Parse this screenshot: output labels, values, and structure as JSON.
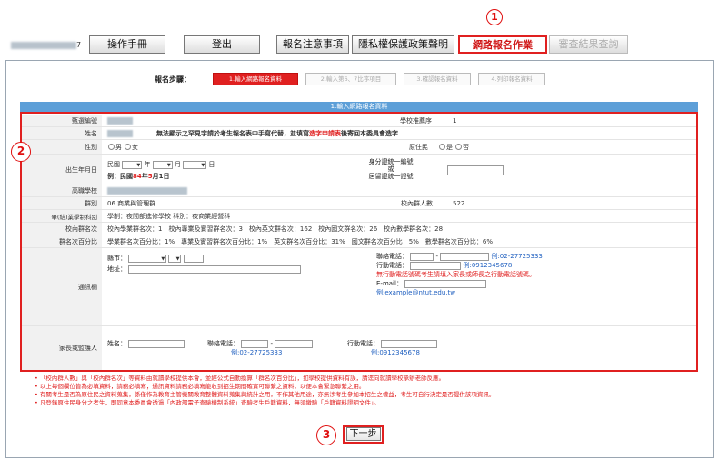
{
  "nav": {
    "user_suffix": "7",
    "buttons": [
      "操作手冊",
      "登出",
      "報名注意事項",
      "隱私權保護政策聲明",
      "網路報名作業",
      "審查結果查詢"
    ]
  },
  "markers": [
    "1",
    "2",
    "3"
  ],
  "steps": {
    "label": "報名步驟：",
    "items": [
      "1.輸入網路報名資料",
      "2.輸入第6、7比序項目",
      "3.確認報名資料",
      "4.列印報名資料"
    ]
  },
  "section_title": "1.輸入網路報名資料",
  "form": {
    "exam_no": {
      "label": "甄選編號"
    },
    "school_recommend": {
      "label": "學校推薦序",
      "value": "1"
    },
    "name": {
      "label": "姓名",
      "note_a": "無法顯示之罕見字請於考生報名表中手寫代替，並填寫",
      "note_b": "造字申請表",
      "note_c": "後寄回本委員會造字"
    },
    "gender": {
      "label": "性別",
      "opt_male": "男",
      "opt_female": "女"
    },
    "aboriginal": {
      "label": "原住民",
      "opt_yes": "是",
      "opt_no": "否"
    },
    "birth": {
      "label": "出生年月日",
      "era": "民國",
      "year_unit": "年",
      "month_unit": "月",
      "day_unit": "日",
      "example_prefix": "例：民國",
      "example_year": "84",
      "example_mid": "年",
      "example_month": "5",
      "example_suffix": "月1日"
    },
    "id": {
      "label_1": "身分證統一編號",
      "label_2": "或",
      "label_3": "居留證統一證號"
    },
    "high_school": {
      "label": "高職學校"
    },
    "group": {
      "label": "群別",
      "value": "06 商業與管理群"
    },
    "school_count": {
      "label": "校內群人數",
      "value": "522"
    },
    "dept": {
      "label": "畢(結)業學制科別",
      "value": "學制：夜間部進修學校 科別：夜商業經營科"
    },
    "rank": {
      "label": "校內群名次",
      "value": "校內學業群名次：1　校內專業及實習群名次：3　校內英文群名次：162　校內國文群名次：26　校內數學群名次：28"
    },
    "rank_pct": {
      "label": "群名次百分比",
      "value": "學業群名次百分比：1%　專業及實習群名次百分比：1%　英文群名次百分比：31%　國文群名次百分比：5%　數學群名次百分比：6%"
    },
    "contact": {
      "label": "通訊欄",
      "city": "縣市：",
      "address": "地址：",
      "phone": "聯絡電話：",
      "phone_example": "例:02-27725333",
      "mobile": "行動電話：",
      "mobile_example": "例:0912345678",
      "mobile_note": "無行動電話號碼考生請填入家長或師長之行動電話號碼。",
      "email": "E-mail：",
      "email_example": "例:example@ntut.edu.tw"
    },
    "guardian": {
      "label": "家長或監護人",
      "name": "姓名：",
      "phone": "聯絡電話：",
      "phone_example": "例:02-27725333",
      "mobile": "行動電話：",
      "mobile_example": "例:0912345678"
    }
  },
  "notes": [
    "「校內群人數」與「校內群名次」等資料由就讀學校提供本會，並經公式自動換算「群名次百分比」，如學校提供資料有誤，請逕向就讀學校承辦老師反應。",
    "以上每個欄位皆為必填資料，請務必填寫；通訊資料請務必填寫能收到招生期間確實可聯繫之資料，以便本會緊急聯繫之用。",
    "有關考生是否為原住民之資料蒐集，係僅作為教育主管機關教育整體資料蒐集與統計之用，不作其他用途，亦無涉考生參加本招生之權益，考生可自行決定是否提供該項資訊。",
    "凡登錄原住民身分之考生，即同意本委員會透過「內政部電子查驗機制系統」查驗考生戶籍資料，無須繳驗「戶籍資料證明文件」。"
  ],
  "next_button": "下一步",
  "colors": {
    "accent": "#e02020",
    "header_blue": "#5d9fd8"
  }
}
